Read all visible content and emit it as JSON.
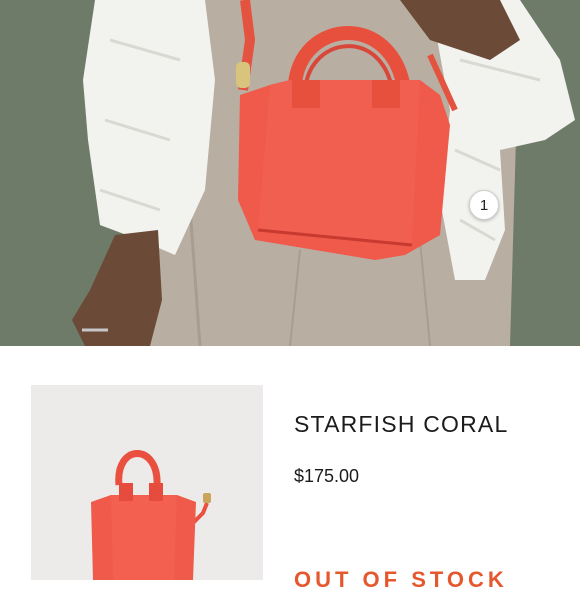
{
  "hero": {
    "hotspot_number": "1"
  },
  "product": {
    "name": "STARFISH CORAL",
    "price": "$175.00",
    "status": "OUT OF STOCK"
  },
  "colors": {
    "bag": "#ef5a4b",
    "status_text": "#e5582e",
    "background_wall": "#6e7a68",
    "thumbnail_bg": "#ecebe9"
  }
}
